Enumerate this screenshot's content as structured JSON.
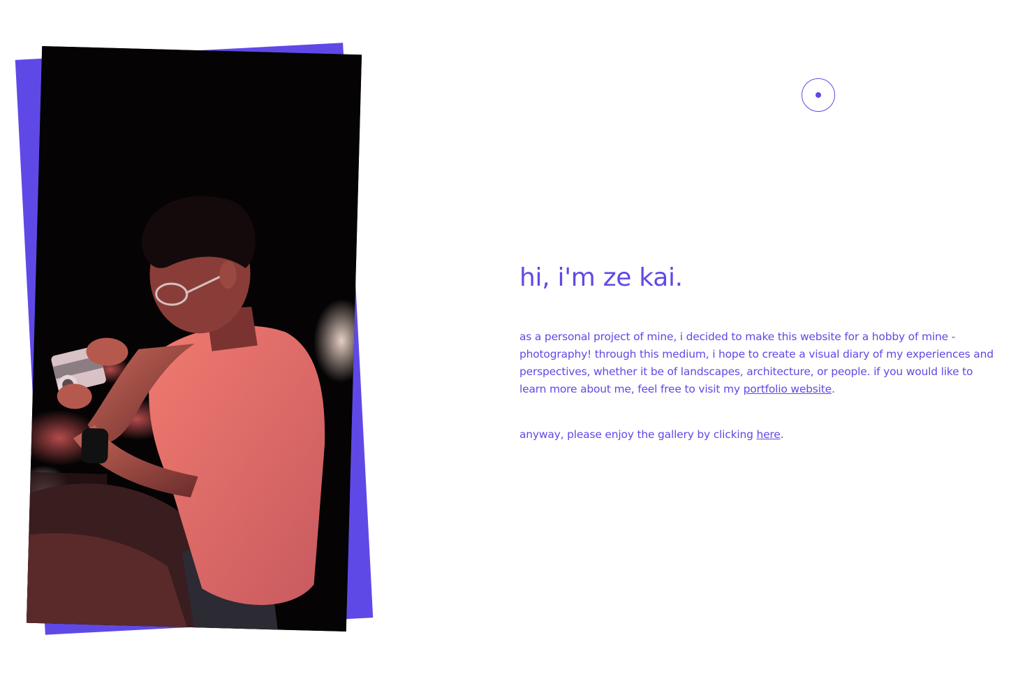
{
  "hero": {
    "title": "hi, i'm ze kai.",
    "about_text": "as a personal project of mine, i decided to make this website for a hobby of mine - photography! through this medium, i hope to create a visual diary of my experiences and perspectives, whether it be of landscapes, architecture, or people. if you would like to learn more about me, feel free to visit my ",
    "portfolio_link_label": "portfolio website",
    "about_suffix": ".",
    "enjoy_text": "anyway, please enjoy the gallery by clicking ",
    "gallery_link_label": "here",
    "enjoy_suffix": "."
  },
  "photo": {
    "alt": "portrait photo of a person holding a camera at night"
  },
  "cursor": {
    "icon": "cursor-ring-icon"
  },
  "colors": {
    "accent": "#5f49e6",
    "background": "#ffffff",
    "photo_bg": "#000000"
  }
}
